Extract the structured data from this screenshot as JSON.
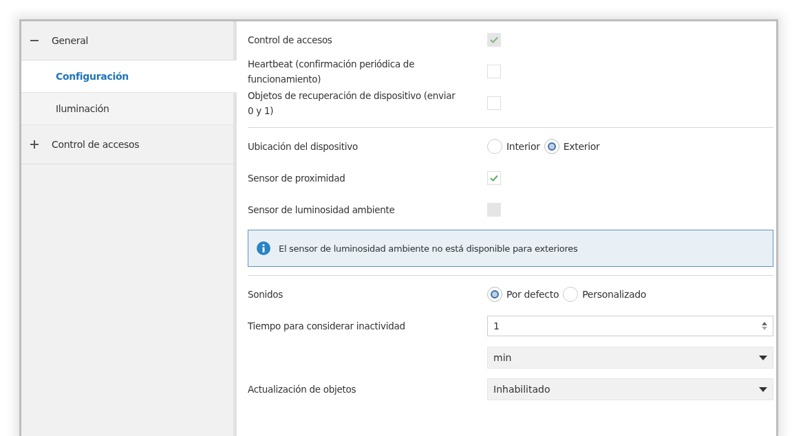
{
  "sidebar": {
    "items": [
      {
        "label": "General",
        "expanded": true,
        "children": [
          {
            "label": "Configuración",
            "selected": true
          },
          {
            "label": "Iluminación",
            "selected": false
          }
        ]
      },
      {
        "label": "Control de accesos",
        "expanded": false
      }
    ]
  },
  "sections": [
    {
      "rows": [
        {
          "kind": "checkbox",
          "label": "Control de accesos",
          "checked": true,
          "disabled": true
        },
        {
          "kind": "checkbox",
          "label": "Heartbeat (confirmación periódica de funcionamiento)",
          "checked": false,
          "disabled": false
        },
        {
          "kind": "checkbox",
          "label": "Objetos de recuperación de dispositivo (enviar 0 y 1)",
          "checked": false,
          "disabled": false
        }
      ]
    },
    {
      "rows": [
        {
          "kind": "radio",
          "label": "Ubicación del dispositivo",
          "options": [
            {
              "label": "Interior",
              "selected": false
            },
            {
              "label": "Exterior",
              "selected": true
            }
          ]
        },
        {
          "kind": "checkbox",
          "label": "Sensor de proximidad",
          "checked": true,
          "disabled": false
        },
        {
          "kind": "checkbox",
          "label": "Sensor de luminosidad ambiente",
          "checked": false,
          "disabled": true
        },
        {
          "kind": "info",
          "text": "El sensor de luminosidad ambiente no está disponible para exteriores"
        }
      ]
    },
    {
      "rows": [
        {
          "kind": "radio",
          "label": "Sonidos",
          "options": [
            {
              "label": "Por defecto",
              "selected": true
            },
            {
              "label": "Personalizado",
              "selected": false
            }
          ]
        },
        {
          "kind": "spin",
          "label": "Tiempo para considerar inactividad",
          "value": "1"
        },
        {
          "kind": "select",
          "value": "min"
        },
        {
          "kind": "select",
          "label": "Actualización de objetos",
          "value": "Inhabilitado"
        }
      ]
    }
  ]
}
